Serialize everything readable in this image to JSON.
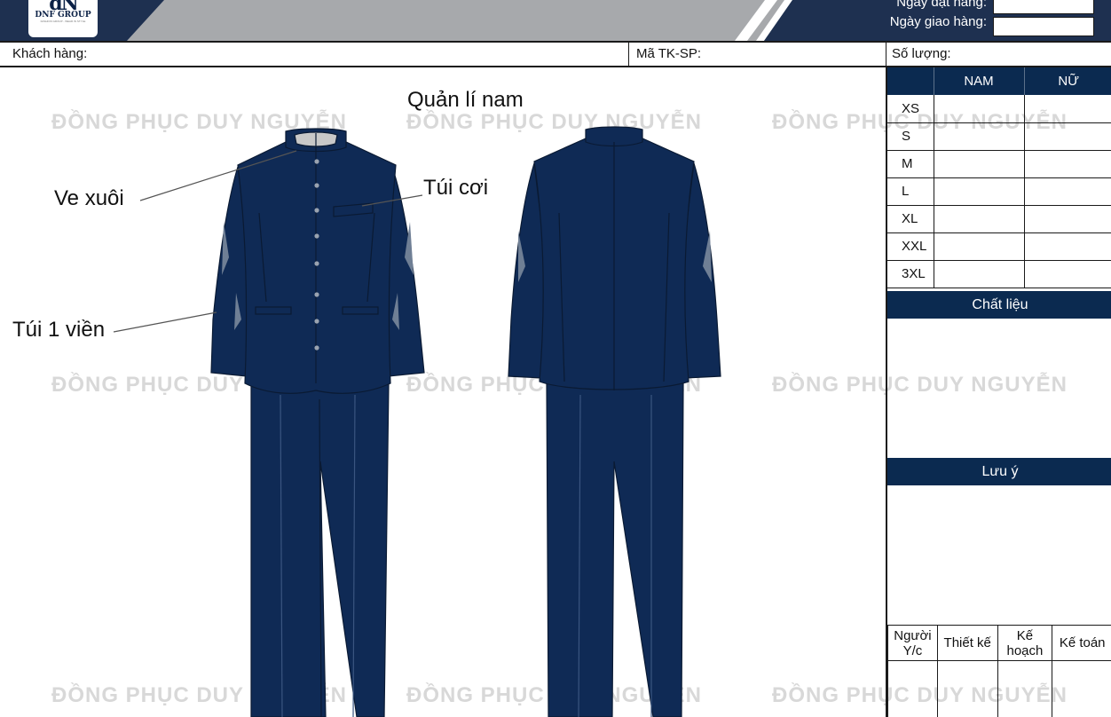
{
  "brand": {
    "logo_mark": "dN",
    "logo_text": "DNF GROUP",
    "tagline": "FASHION GROUP - WEAR IN STYLE"
  },
  "header": {
    "order_date_label": "Ngày đặt hàng:",
    "delivery_date_label": "Ngày giao hàng:"
  },
  "info_row": {
    "customer_label": "Khách hàng:",
    "design_code_label": "Mã TK-SP:",
    "quantity_label": "Số lượng:"
  },
  "size_table": {
    "col_size": "",
    "col_male": "NAM",
    "col_female": "NỮ",
    "sizes": [
      "XS",
      "S",
      "M",
      "L",
      "XL",
      "XXL",
      "3XL"
    ]
  },
  "material_label": "Chất liệu",
  "notes_label": "Lưu ý",
  "signatures": {
    "requester": "Người Y/c",
    "designer": "Thiết kế",
    "planner": "Kế hoạch",
    "accountant": "Kế toán"
  },
  "drawing": {
    "title": "Quản lí nam",
    "callouts": {
      "collar": "Ve xuôi",
      "chest_pocket": "Túi cơi",
      "side_pocket": "Túi 1 viền"
    },
    "watermark": "ĐỒNG PHỤC DUY NGUYỄN"
  },
  "colors": {
    "navy_panel": "#0b2a50",
    "garment_navy": "#0f2a55",
    "header_grey": "#a7a9ac",
    "header_dark": "#1e3050"
  }
}
